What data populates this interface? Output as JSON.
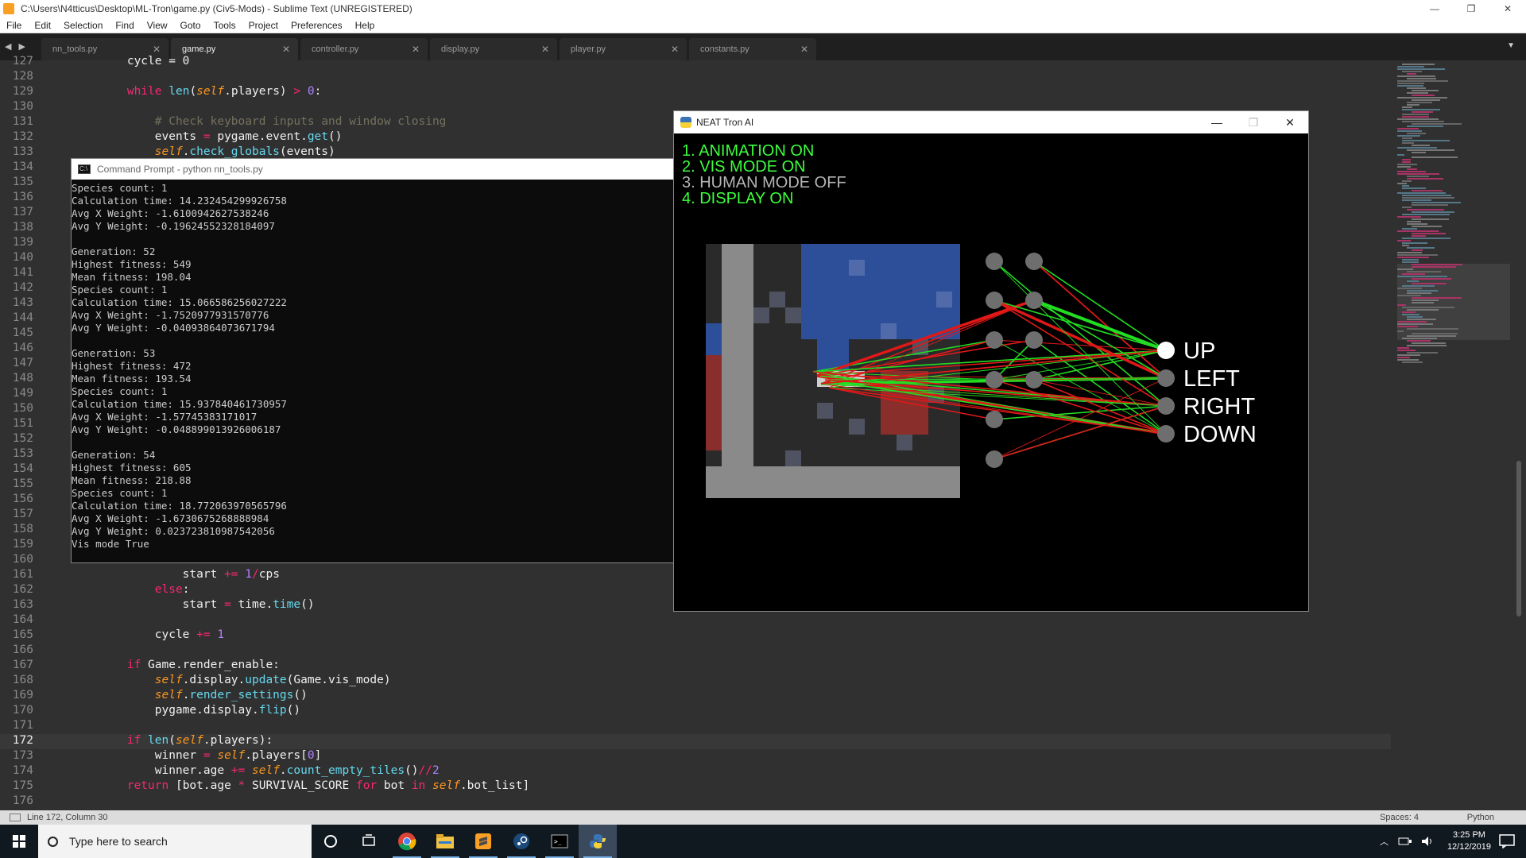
{
  "window": {
    "title": "C:\\Users\\N4tticus\\Desktop\\ML-Tron\\game.py (Civ5-Mods) - Sublime Text (UNREGISTERED)",
    "minimize": "—",
    "maximize": "❐",
    "close": "✕"
  },
  "menu": [
    "File",
    "Edit",
    "Selection",
    "Find",
    "View",
    "Goto",
    "Tools",
    "Project",
    "Preferences",
    "Help"
  ],
  "tabs": [
    {
      "label": "nn_tools.py",
      "active": false
    },
    {
      "label": "game.py",
      "active": true
    },
    {
      "label": "controller.py",
      "active": false
    },
    {
      "label": "display.py",
      "active": false
    },
    {
      "label": "player.py",
      "active": false
    },
    {
      "label": "constants.py",
      "active": false
    }
  ],
  "tab_nav": "◀ ▶",
  "tab_close": "✕",
  "tab_dropdown": "▼",
  "editor": {
    "current_line": 172,
    "lines": [
      {
        "n": "127",
        "html": "        cycle = 0"
      },
      {
        "n": "128",
        "html": ""
      },
      {
        "n": "129",
        "html": "        <span class=\"kw\">while</span> <span class=\"fn\">len</span>(<span class=\"slf\">self</span>.players) <span class=\"op\">&gt;</span> <span class=\"num\">0</span>:"
      },
      {
        "n": "130",
        "html": ""
      },
      {
        "n": "131",
        "html": "            <span class=\"cmt\"># Check keyboard inputs and window closing</span>"
      },
      {
        "n": "132",
        "html": "            events <span class=\"op\">=</span> pygame.event.<span class=\"fn\">get</span>()"
      },
      {
        "n": "133",
        "html": "            <span class=\"slf\">self</span>.<span class=\"fn\">check_globals</span>(events)"
      },
      {
        "n": "134",
        "html": ""
      },
      {
        "n": "135",
        "html": ""
      },
      {
        "n": "136",
        "html": ""
      },
      {
        "n": "137",
        "html": ""
      },
      {
        "n": "138",
        "html": ""
      },
      {
        "n": "139",
        "html": ""
      },
      {
        "n": "140",
        "html": ""
      },
      {
        "n": "141",
        "html": ""
      },
      {
        "n": "142",
        "html": ""
      },
      {
        "n": "143",
        "html": ""
      },
      {
        "n": "144",
        "html": ""
      },
      {
        "n": "145",
        "html": ""
      },
      {
        "n": "146",
        "html": ""
      },
      {
        "n": "147",
        "html": ""
      },
      {
        "n": "148",
        "html": ""
      },
      {
        "n": "149",
        "html": ""
      },
      {
        "n": "150",
        "html": ""
      },
      {
        "n": "151",
        "html": ""
      },
      {
        "n": "152",
        "html": ""
      },
      {
        "n": "153",
        "html": ""
      },
      {
        "n": "154",
        "html": ""
      },
      {
        "n": "155",
        "html": ""
      },
      {
        "n": "156",
        "html": ""
      },
      {
        "n": "157",
        "html": ""
      },
      {
        "n": "158",
        "html": ""
      },
      {
        "n": "159",
        "html": ""
      },
      {
        "n": "160",
        "html": ""
      },
      {
        "n": "161",
        "html": "                start <span class=\"op\">+=</span> <span class=\"num\">1</span><span class=\"op\">/</span>cps"
      },
      {
        "n": "162",
        "html": "            <span class=\"kw\">else</span>:"
      },
      {
        "n": "163",
        "html": "                start <span class=\"op\">=</span> time.<span class=\"fn\">time</span>()"
      },
      {
        "n": "164",
        "html": ""
      },
      {
        "n": "165",
        "html": "            cycle <span class=\"op\">+=</span> <span class=\"num\">1</span>"
      },
      {
        "n": "166",
        "html": ""
      },
      {
        "n": "167",
        "html": "        <span class=\"kw\">if</span> Game.render_enable:"
      },
      {
        "n": "168",
        "html": "            <span class=\"slf\">self</span>.display.<span class=\"fn\">update</span>(Game.vis_mode)"
      },
      {
        "n": "169",
        "html": "            <span class=\"slf\">self</span>.<span class=\"fn\">render_settings</span>()"
      },
      {
        "n": "170",
        "html": "            pygame.display.<span class=\"fn\">flip</span>()"
      },
      {
        "n": "171",
        "html": ""
      },
      {
        "n": "172",
        "html": "        <span class=\"kw\">if</span> <span class=\"fn\">len</span>(<span class=\"slf\">self</span>.players):"
      },
      {
        "n": "173",
        "html": "            winner <span class=\"op\">=</span> <span class=\"slf\">self</span>.players[<span class=\"num\">0</span>]"
      },
      {
        "n": "174",
        "html": "            winner.age <span class=\"op\">+=</span> <span class=\"slf\">self</span>.<span class=\"fn\">count_empty_tiles</span>()<span class=\"op\">//</span><span class=\"num\">2</span>"
      },
      {
        "n": "175",
        "html": "        <span class=\"kw\">return</span> [bot.age <span class=\"op\">*</span> SURVIVAL_SCORE <span class=\"kw\">for</span> bot <span class=\"kw\">in</span> <span class=\"slf\">self</span>.bot_list]"
      },
      {
        "n": "176",
        "html": ""
      }
    ]
  },
  "status": {
    "position": "Line 172, Column 30",
    "spaces": "Spaces: 4",
    "syntax": "Python"
  },
  "cmd": {
    "title": "Command Prompt - python  nn_tools.py",
    "icon_text": "C:\\",
    "output": "Species count: 1\nCalculation time: 14.232454299926758\nAvg X Weight: -1.6100942627538246\nAvg Y Weight: -0.19624552328184097\n\nGeneration: 52\nHighest fitness: 549\nMean fitness: 198.04\nSpecies count: 1\nCalculation time: 15.066586256027222\nAvg X Weight: -1.7520977931570776\nAvg Y Weight: -0.04093864073671794\n\nGeneration: 53\nHighest fitness: 472\nMean fitness: 193.54\nSpecies count: 1\nCalculation time: 15.937840461730957\nAvg X Weight: -1.57745383171017\nAvg Y Weight: -0.048899013926006187\n\nGeneration: 54\nHighest fitness: 605\nMean fitness: 218.88\nSpecies count: 1\nCalculation time: 18.772063970565796\nAvg X Weight: -1.6730675268888984\nAvg Y Weight: 0.023723810987542056\nVis mode True"
  },
  "neat": {
    "title": "NEAT Tron AI",
    "options": [
      {
        "text": "1. ANIMATION ON",
        "color": "#3cff3c"
      },
      {
        "text": "2. VIS MODE ON",
        "color": "#3cff3c"
      },
      {
        "text": "3. HUMAN MODE OFF",
        "color": "#b4b4b4"
      },
      {
        "text": "4. DISPLAY ON",
        "color": "#3cff3c"
      }
    ],
    "outputs": [
      "UP",
      "LEFT",
      "RIGHT",
      "DOWN"
    ],
    "active_output": "UP"
  },
  "taskbar": {
    "search_placeholder": "Type here to search",
    "time": "3:25 PM",
    "date": "12/12/2019",
    "apps": [
      "task-view-icon",
      "chrome-icon",
      "file-explorer-icon",
      "sublime-text-icon",
      "steam-icon",
      "command-prompt-icon",
      "python-icon"
    ]
  },
  "colors": {
    "accent": "#f92672",
    "function": "#66d9ef",
    "self": "#fd971f",
    "number": "#ae81ff",
    "comment": "#75715e",
    "blue_team": "#2d4f9a",
    "red_team": "#8a2e2b"
  }
}
